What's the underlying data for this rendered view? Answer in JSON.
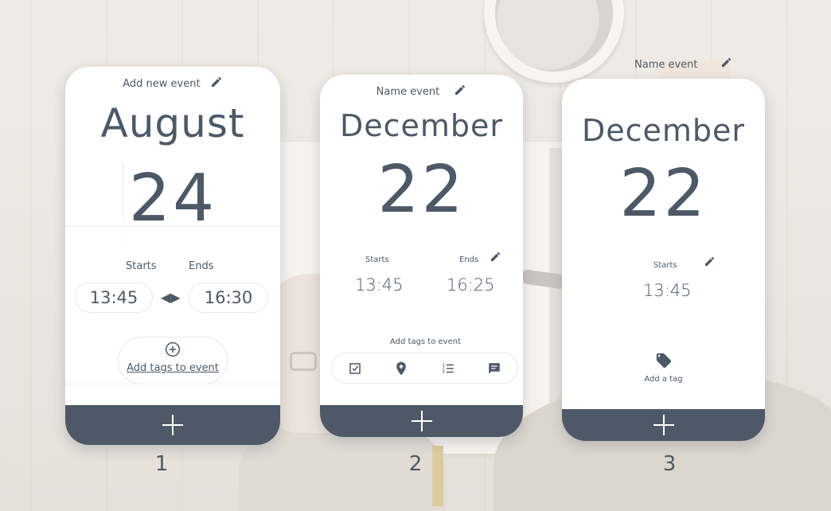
{
  "cards": [
    {
      "number": "1",
      "header": "Add new event",
      "month": "August",
      "day": "24",
      "starts_label": "Starts",
      "ends_label": "Ends",
      "start_time": "13:45",
      "end_time": "16:30",
      "swap_arrows": "◀▶",
      "tags_link": "Add tags to event",
      "icons": [
        "pencil-icon",
        "add-circle-icon",
        "plus-icon"
      ]
    },
    {
      "number": "2",
      "header": "Name event",
      "month": "December",
      "day": "22",
      "starts_label": "Starts",
      "ends_label": "Ends",
      "start_time": "13:45",
      "end_time": "16:25",
      "tags_title": "Add tags to event",
      "tag_icons": [
        "checkbox-icon",
        "location-pin-icon",
        "numbered-list-icon",
        "comment-icon"
      ],
      "icons": [
        "pencil-icon",
        "plus-icon"
      ]
    },
    {
      "number": "3",
      "header": "Name event",
      "month": "December",
      "day": "22",
      "starts_label": "Starts",
      "start_time": "13:45",
      "tag_label": "Add a tag",
      "icons": [
        "pencil-icon",
        "tag-icon",
        "plus-icon"
      ]
    }
  ],
  "colors": {
    "primary": "#4d5966",
    "card": "#ffffff",
    "border": "#e3e6ea"
  }
}
